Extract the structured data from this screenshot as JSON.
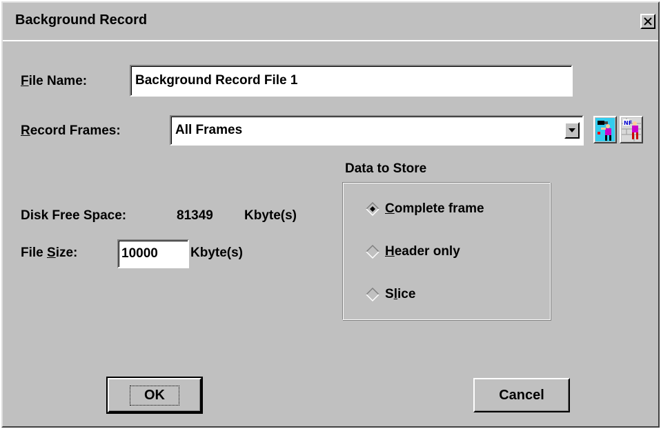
{
  "dialog": {
    "title": "Background Record",
    "close_label": "X"
  },
  "file_name": {
    "label_key": "F",
    "label_rest": "ile Name:",
    "value": "Background Record File 1"
  },
  "record_frames": {
    "label_key": "R",
    "label_rest": "ecord Frames:",
    "selected": "All Frames"
  },
  "toolbar_icons": [
    "video-record-icon",
    "new-frames-icon"
  ],
  "disk_free": {
    "label": "Disk Free Space:",
    "value": "81349",
    "unit": "Kbyte(s)"
  },
  "file_size": {
    "label_pre": "File ",
    "label_key": "S",
    "label_rest": "ize:",
    "value": "10000",
    "unit": "Kbyte(s)"
  },
  "data_to_store": {
    "title": "Data to Store",
    "options": [
      {
        "pre": "",
        "key": "C",
        "rest": "omplete frame",
        "selected": true
      },
      {
        "pre": "",
        "key": "H",
        "rest": "eader only",
        "selected": false
      },
      {
        "pre": "S",
        "key": "l",
        "rest": "ice",
        "selected": false
      }
    ]
  },
  "buttons": {
    "ok": "OK",
    "cancel": "Cancel"
  },
  "colors": {
    "face": "#c0c0c0",
    "shadow": "#808080",
    "highlight": "#ffffff",
    "text": "#000000"
  }
}
